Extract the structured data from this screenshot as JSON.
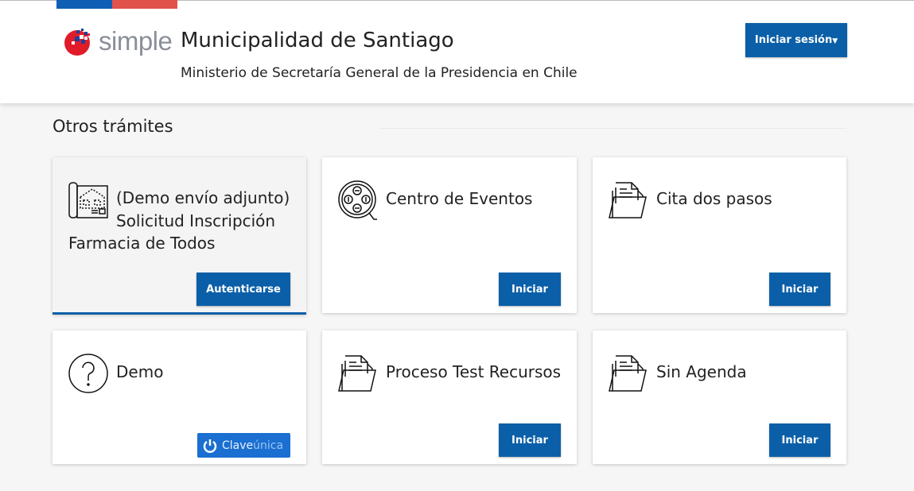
{
  "header": {
    "logo_text": "simple",
    "title": "Municipalidad de Santiago",
    "subtitle": "Ministerio de Secretaría General de la Presidencia en Chile",
    "login_label": "Iniciar sesión",
    "flag_colors": [
      "#0f5fb5",
      "#e0524a"
    ]
  },
  "section": {
    "title": "Otros trámites"
  },
  "cards": [
    {
      "title_line1": "(Demo envío adjunto) Solicitud Inscripción",
      "title_line2": "Farmacia de Todos",
      "icon": "blueprint-icon",
      "button": "Autenticarse"
    },
    {
      "title": "Centro de Eventos",
      "icon": "film-reel-icon",
      "button": "Iniciar"
    },
    {
      "title": "Cita dos pasos",
      "icon": "folder-document-icon",
      "button": "Iniciar"
    },
    {
      "title": "Demo",
      "icon": "question-circle-icon",
      "button": "Claveúnica",
      "button_prefix": "Clave",
      "button_suffix": "única"
    },
    {
      "title": "Proceso Test Recursos",
      "icon": "folder-document-icon",
      "button": "Iniciar"
    },
    {
      "title": "Sin Agenda",
      "icon": "folder-document-icon",
      "button": "Iniciar"
    }
  ],
  "colors": {
    "primary": "#0b5fa8",
    "claveunica": "#1a6fd1",
    "background": "#f6f6f6"
  }
}
